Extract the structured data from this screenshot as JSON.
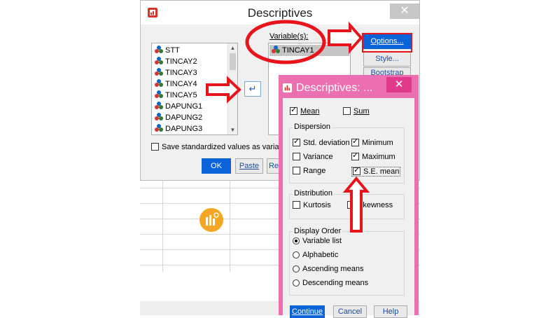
{
  "main_dialog": {
    "title": "Descriptives",
    "close_glyph": "✕",
    "source_variables": [
      "STT",
      "TINCAY2",
      "TINCAY3",
      "TINCAY4",
      "TINCAY5",
      "DAPUNG1",
      "DAPUNG2",
      "DAPUNG3"
    ],
    "variables_label": "Variable(s):",
    "selected_variables": [
      "TINCAY1"
    ],
    "move_glyph": "↵",
    "buttons": {
      "options": "Options...",
      "style": "Style...",
      "bootstrap": "Bootstrap"
    },
    "save_std_label": "Save standardized values as variab",
    "bottom_buttons": {
      "ok": "OK",
      "paste": "Paste",
      "reset": "Re"
    }
  },
  "options_dialog": {
    "title": "Descriptives: ...",
    "close_glyph": "✕",
    "mean": {
      "label": "Mean",
      "checked": true
    },
    "sum": {
      "label": "Sum",
      "checked": false
    },
    "dispersion": {
      "title": "Dispersion",
      "items": [
        {
          "label": "Std. deviation",
          "checked": true
        },
        {
          "label": "Minimum",
          "checked": true
        },
        {
          "label": "Variance",
          "checked": false
        },
        {
          "label": "Maximum",
          "checked": true
        },
        {
          "label": "Range",
          "checked": false
        },
        {
          "label": "S.E. mean",
          "checked": true
        }
      ]
    },
    "distribution": {
      "title": "Distribution",
      "items": [
        {
          "label": "Kurtosis",
          "checked": false
        },
        {
          "label": "Skewness",
          "checked": false
        }
      ]
    },
    "display_order": {
      "title": "Display Order",
      "items": [
        {
          "label": "Variable list",
          "selected": true
        },
        {
          "label": "Alphabetic",
          "selected": false
        },
        {
          "label": "Ascending means",
          "selected": false
        },
        {
          "label": "Descending means",
          "selected": false
        }
      ]
    },
    "buttons": {
      "continue": "Continue",
      "cancel": "Cancel",
      "help": "Help"
    }
  },
  "colors": {
    "annotation_red": "#e8141c",
    "dialog_pink": "#ec6fb1",
    "accent_blue": "#0a64d8",
    "watermark_orange": "#f5a623"
  }
}
